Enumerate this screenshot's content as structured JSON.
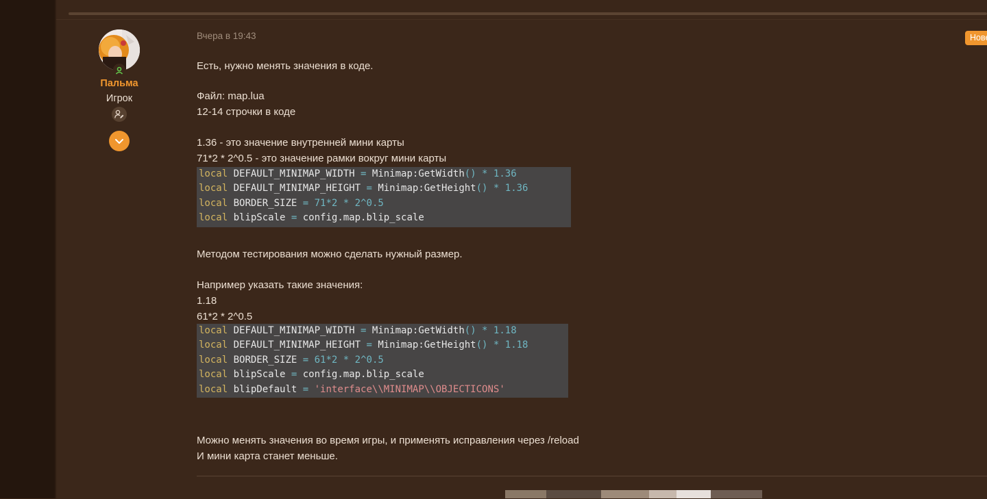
{
  "post": {
    "author": {
      "name": "Пальма",
      "title": "Игрок"
    },
    "timestamp": "Вчера в 19:43",
    "badge": "Нове",
    "paragraphs": {
      "p1": "Есть, нужно менять значения в коде.",
      "p2": "Файл: map.lua",
      "p3": "12-14 строчки в коде",
      "p4": "1.36 - это значение внутренней мини карты",
      "p5": "71*2 * 2^0.5 - это значение рамки вокруг мини карты",
      "p6": "Методом тестирования можно сделать нужный размер.",
      "p7": "Например указать такие значения:",
      "p8": "1.18",
      "p9": "61*2 * 2^0.5",
      "p10": "Можно менять значения во время игры, и применять исправления через /reload",
      "p11": "И мини карта станет меньше."
    },
    "code1": {
      "kw": "local",
      "l1_a": " DEFAULT_MINIMAP_WIDTH ",
      "l1_b": "=",
      "l1_c": " Minimap:GetWidth",
      "l1_d": "()",
      "l1_e": " * ",
      "l1_f": "1.36",
      "l2_a": " DEFAULT_MINIMAP_HEIGHT ",
      "l2_b": "=",
      "l2_c": " Minimap:GetHeight",
      "l2_d": "()",
      "l2_e": " * ",
      "l2_f": "1.36",
      "l3_a": " BORDER_SIZE ",
      "l3_b": "=",
      "l3_c": " 71",
      "l3_d": "*",
      "l3_e": "2",
      "l3_f": " * ",
      "l3_g": "2",
      "l3_h": "^",
      "l3_i": "0.5",
      "l4_a": " blipScale ",
      "l4_b": "=",
      "l4_c": " config.map.blip_scale"
    },
    "code2": {
      "kw": "local",
      "l1_a": " DEFAULT_MINIMAP_WIDTH ",
      "l1_b": "=",
      "l1_c": " Minimap:GetWidth",
      "l1_d": "()",
      "l1_e": " * ",
      "l1_f": "1.18",
      "l2_a": " DEFAULT_MINIMAP_HEIGHT ",
      "l2_b": "=",
      "l2_c": " Minimap:GetHeight",
      "l2_d": "()",
      "l2_e": " * ",
      "l2_f": "1.18",
      "l3_a": " BORDER_SIZE ",
      "l3_b": "=",
      "l3_c": " 61",
      "l3_d": "*",
      "l3_e": "2",
      "l3_f": " * ",
      "l3_g": "2",
      "l3_h": "^",
      "l3_i": "0.5",
      "l4_a": " blipScale ",
      "l4_b": "=",
      "l4_c": " config.map.blip_scale",
      "l5_a": " blipDefault ",
      "l5_b": "=",
      "l5_c": " ",
      "l5_d": "'interface\\\\MINIMAP\\\\OBJECTICONS'"
    }
  },
  "colors": {
    "accent": "#f0962e",
    "background": "#3b271a",
    "code_background": "#474545",
    "keyword": "#d3b45f",
    "operator": "#6fb6c2",
    "string": "#df8c8c"
  },
  "icons": {
    "online": "online-status-icon",
    "banner": "user-edit-icon",
    "expand": "chevron-down-icon"
  }
}
